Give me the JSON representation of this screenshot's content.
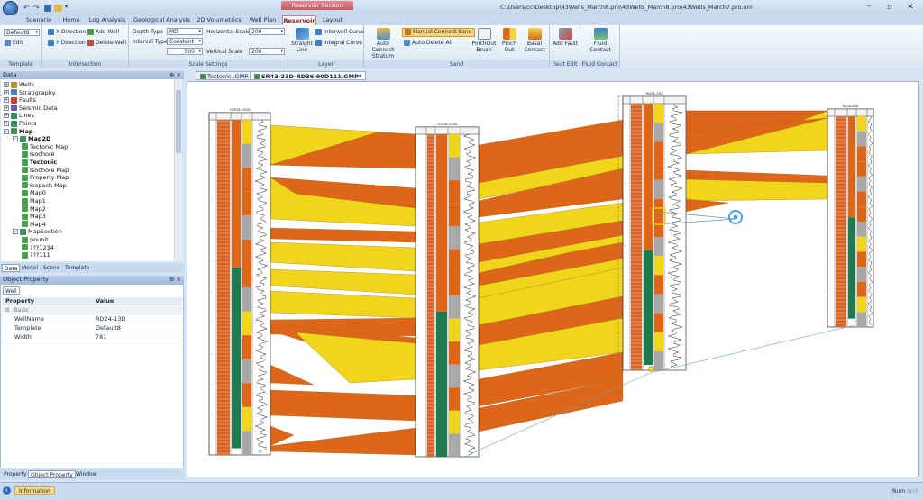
{
  "window": {
    "title": "C:\\Users\\cc\\Desktop\\43Wells_March8.pro\\43Wells_March8.pro\\43Wells_March7.pro.uni",
    "context_tab": "Reservoir Section"
  },
  "ribbon_tabs": [
    "Scenario",
    "Home",
    "Log Analysis",
    "Geological Analysis",
    "2D Volumetrics",
    "Well Plan",
    "Reservoir",
    "Layout"
  ],
  "active_tab": "Reservoir",
  "ribbon": {
    "template": {
      "select": "Default8",
      "edit": "Edit",
      "label": "Template"
    },
    "intersection": {
      "x_dir": "X Direction",
      "y_dir": "Y Direction",
      "add_well": "Add Well",
      "delete_well": "Delete Well",
      "label": "Intersection"
    },
    "scale": {
      "depth_type_label": "Depth Type",
      "depth_type": "MD",
      "interval_type_label": "Interval Type",
      "interval_type": "Constant",
      "interval_val": "500",
      "h_scale_label": "Horizontal Scale",
      "h_scale": "200",
      "v_scale_label": "Vertical Scale",
      "v_scale": "200",
      "label": "Scale Settings"
    },
    "layer": {
      "straight": "Straight Line",
      "interwell": "Interwell Curve",
      "integral": "Integral Curve",
      "label": "Layer"
    },
    "sand": {
      "auto_connect": "Auto Connect Stratum",
      "manual_connect": "Manual Connect Sand",
      "auto_delete": "Auto Delete All",
      "pinchout_brush": "PinchOut Brush",
      "pinch_out": "Pinch Out",
      "basal_contact": "Basal Contact",
      "label": "Sand"
    },
    "fault": {
      "add": "Add Fault",
      "label": "Fault Edit"
    },
    "fluid": {
      "contact": "Fluid Contact",
      "label": "Fluid Contact"
    }
  },
  "data_panel": {
    "title": "Data",
    "pin": "⊕ ×"
  },
  "tree": [
    {
      "label": "Wells",
      "lvl": 0,
      "exp": "+",
      "ic": "#c08a2a"
    },
    {
      "label": "Stratigraphy",
      "lvl": 0,
      "exp": "+",
      "ic": "#4e7fbd"
    },
    {
      "label": "Faults",
      "lvl": 0,
      "exp": "+",
      "ic": "#c9423a"
    },
    {
      "label": "Seismic Data",
      "lvl": 0,
      "exp": "+",
      "ic": "#6a58a8"
    },
    {
      "label": "Lines",
      "lvl": 0,
      "exp": "+",
      "ic": "#3d8f5a"
    },
    {
      "label": "Points",
      "lvl": 0,
      "exp": "+",
      "ic": "#3d8f5a"
    },
    {
      "label": "Map",
      "lvl": 0,
      "exp": "-",
      "ic": "#3d8f5a",
      "bold": true
    },
    {
      "label": "Map2D",
      "lvl": 1,
      "exp": "-",
      "ic": "#3d8f5a",
      "bold": true
    },
    {
      "label": "Tectonic Map",
      "lvl": 2,
      "ic": "#48a04c"
    },
    {
      "label": "Isochore",
      "lvl": 2,
      "ic": "#48a04c"
    },
    {
      "label": "Tectonic",
      "lvl": 2,
      "ic": "#48a04c",
      "bold": true
    },
    {
      "label": "Isochore Map",
      "lvl": 2,
      "ic": "#48a04c"
    },
    {
      "label": "Property Map",
      "lvl": 2,
      "ic": "#48a04c"
    },
    {
      "label": "Isopach Map",
      "lvl": 2,
      "ic": "#48a04c"
    },
    {
      "label": "Map0",
      "lvl": 2,
      "ic": "#48a04c"
    },
    {
      "label": "Map1",
      "lvl": 2,
      "ic": "#48a04c"
    },
    {
      "label": "Map2",
      "lvl": 2,
      "ic": "#48a04c"
    },
    {
      "label": "Map3",
      "lvl": 2,
      "ic": "#48a04c"
    },
    {
      "label": "Map4",
      "lvl": 2,
      "ic": "#48a04c"
    },
    {
      "label": "MapSection",
      "lvl": 1,
      "exp": "-",
      "ic": "#3d8f5a"
    },
    {
      "label": "pounit",
      "lvl": 2,
      "ic": "#48a04c"
    },
    {
      "label": "???1234",
      "lvl": 2,
      "ic": "#48a04c"
    },
    {
      "label": "???111",
      "lvl": 2,
      "ic": "#48a04c"
    }
  ],
  "data_tabs": [
    "Data",
    "Model",
    "Scene",
    "Template"
  ],
  "obj_panel": {
    "title": "Object Property",
    "subtab": "Well",
    "col_prop": "Property",
    "col_val": "Value",
    "group": "Basic",
    "rows": [
      {
        "k": "WellName",
        "v": "RD24-13D"
      },
      {
        "k": "Template",
        "v": "Default8"
      },
      {
        "k": "Width",
        "v": "781"
      }
    ]
  },
  "bottom_tabs": [
    "Property",
    "Object Property",
    "Window"
  ],
  "status": {
    "info": "Information",
    "num": "Num",
    "scrl": "Scrl"
  },
  "doc_tabs": [
    "Tectonic .GMP",
    "SR43-23D-RD36-90D111.GMP*"
  ],
  "wells": [
    {
      "name": "CDP26-100D"
    },
    {
      "name": "CDP26-120D"
    },
    {
      "name": "RD24-13D"
    },
    {
      "name": "RD26-60D"
    }
  ],
  "colors": {
    "orange": "#dd6619",
    "yellow": "#f0d51a",
    "green": "#1e7a4f",
    "gray": "#a8a8a8"
  }
}
